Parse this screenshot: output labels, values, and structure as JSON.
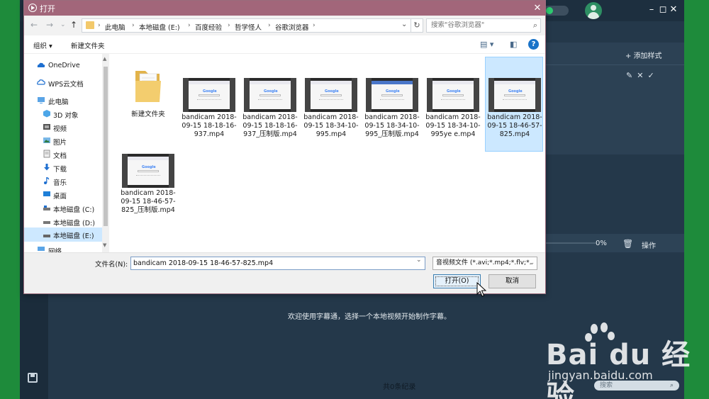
{
  "dialog": {
    "title": "打开",
    "close_symbol": "✕",
    "breadcrumbs": [
      "此电脑",
      "本地磁盘 (E:)",
      "百度经验",
      "哲学怪人",
      "谷歌浏览器"
    ],
    "search_placeholder": "搜索\"谷歌浏览器\"",
    "toolbar": {
      "organize": "组织 ▾",
      "new_folder": "新建文件夹"
    },
    "nav_items": [
      {
        "label": "OneDrive",
        "icon": "cloud-icon"
      },
      {
        "label": "WPS云文档",
        "icon": "cloud-icon"
      },
      {
        "label": "此电脑",
        "icon": "computer-icon"
      },
      {
        "label": "3D 对象",
        "icon": "cube-icon"
      },
      {
        "label": "视频",
        "icon": "video-icon"
      },
      {
        "label": "图片",
        "icon": "picture-icon"
      },
      {
        "label": "文档",
        "icon": "document-icon"
      },
      {
        "label": "下载",
        "icon": "download-icon"
      },
      {
        "label": "音乐",
        "icon": "music-icon"
      },
      {
        "label": "桌面",
        "icon": "desktop-icon"
      },
      {
        "label": "本地磁盘 (C:)",
        "icon": "drive-icon"
      },
      {
        "label": "本地磁盘 (D:)",
        "icon": "drive-icon"
      },
      {
        "label": "本地磁盘 (E:)",
        "icon": "drive-icon"
      },
      {
        "label": "网络",
        "icon": "network-icon"
      }
    ],
    "files": [
      {
        "name": "新建文件夹",
        "type": "folder"
      },
      {
        "name": "bandicam 2018-09-15 18-18-16-937.mp4",
        "type": "video"
      },
      {
        "name": "bandicam 2018-09-15 18-18-16-937_压制版.mp4",
        "type": "video"
      },
      {
        "name": "bandicam 2018-09-15 18-34-10-995.mp4",
        "type": "video"
      },
      {
        "name": "bandicam 2018-09-15 18-34-10-995_压制版.mp4",
        "type": "video"
      },
      {
        "name": "bandicam 2018-09-15 18-34-10-995ye e.mp4",
        "type": "video"
      },
      {
        "name": "bandicam 2018-09-15 18-46-57-825.mp4",
        "type": "video",
        "selected": true
      },
      {
        "name": "bandicam 2018-09-15 18-46-57-825_压制版.mp4",
        "type": "video"
      }
    ],
    "filename_label": "文件名(N):",
    "filename_value": "bandicam 2018-09-15 18-46-57-825.mp4",
    "filetype_value": "音视频文件 (*.avi;*.mp4;*.flv;*.",
    "open_button": "打开(O)",
    "cancel_button": "取消"
  },
  "app": {
    "add_style": "添加样式",
    "progress_pct": "0%",
    "ops_label": "操作",
    "welcome": "欢迎使用字幕通，选择一个本地视频开始制作字幕。",
    "record_count": "共0条纪录",
    "search_placeholder": "搜索"
  },
  "watermark": {
    "text": "Bai du 经验",
    "url": "jingyan.baidu.com"
  },
  "colors": {
    "titlebar": "#a2667a",
    "app_bg": "#24384a",
    "green": "#1e8b3b",
    "selection": "#cce8ff"
  }
}
